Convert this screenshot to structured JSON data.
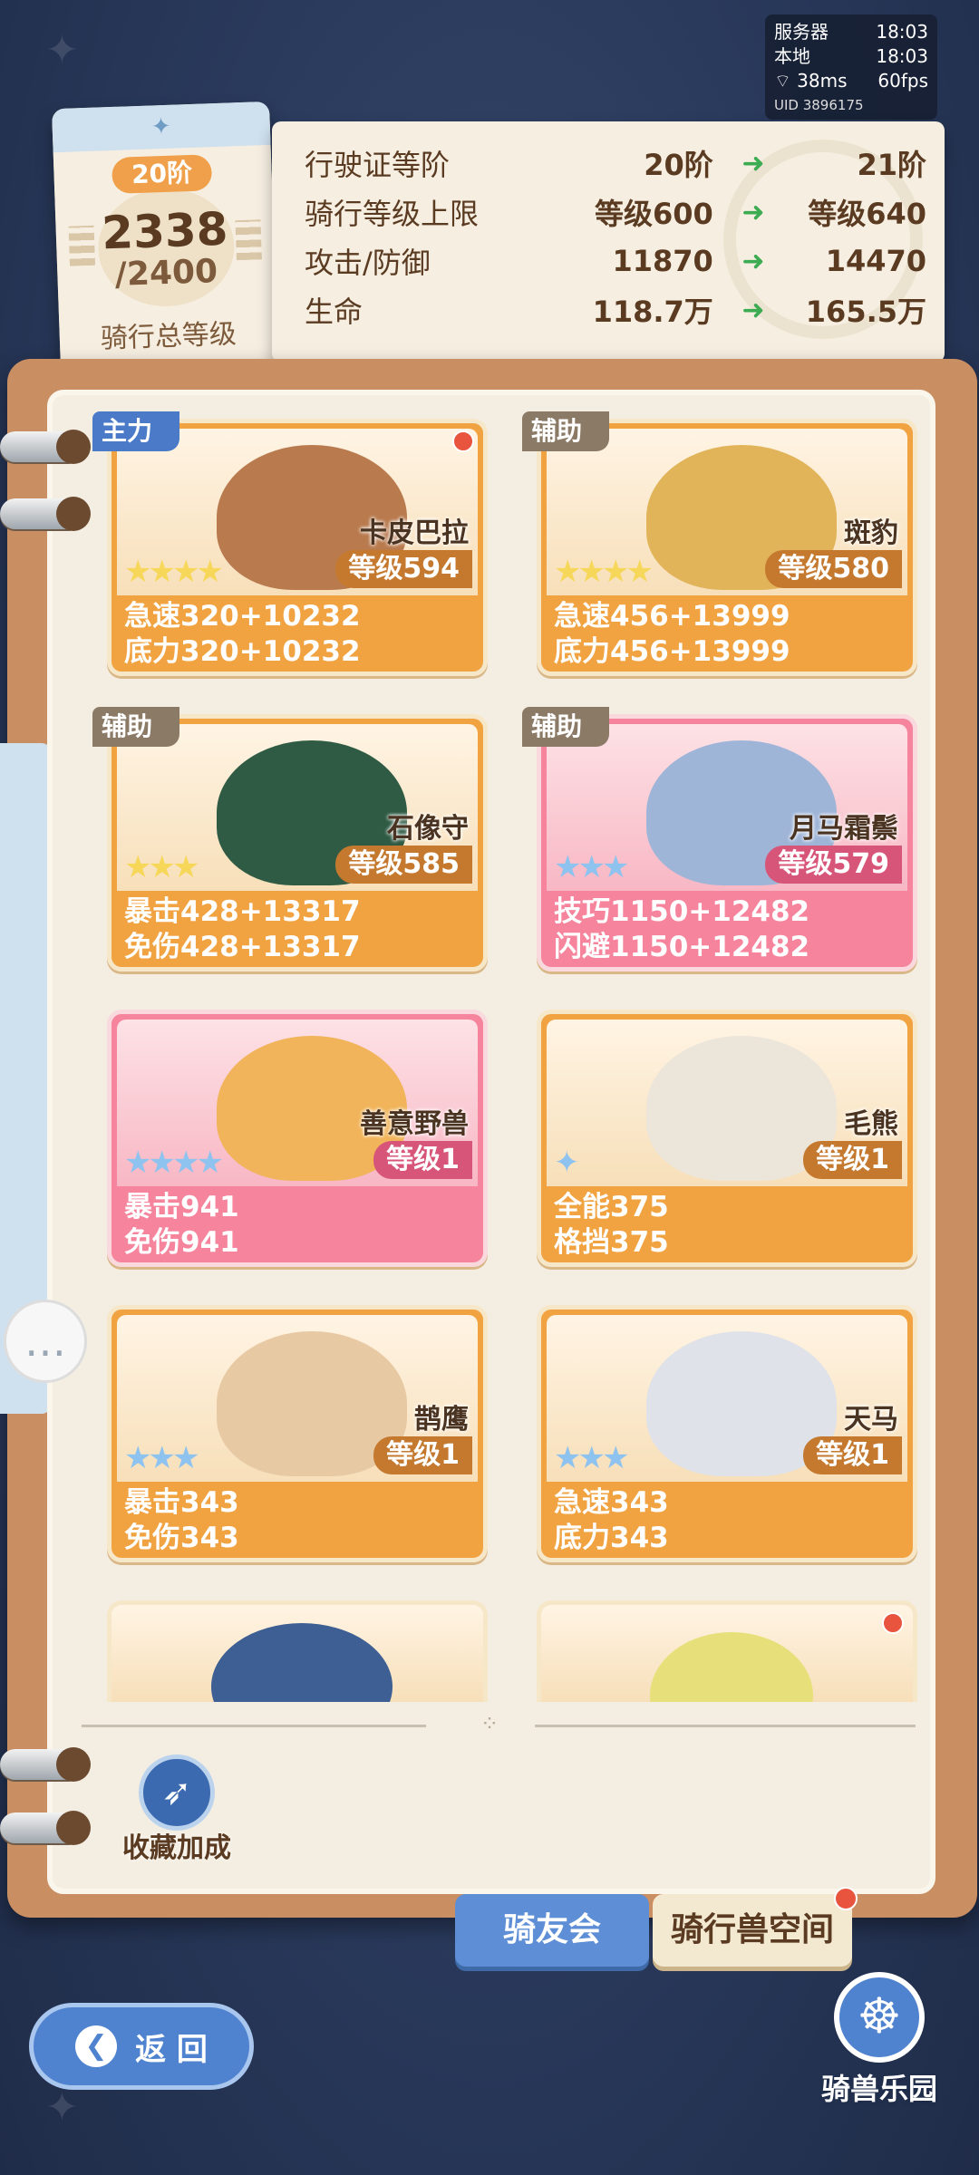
{
  "status": {
    "server_label": "服务器",
    "server_time": "18:03",
    "local_label": "本地",
    "local_time": "18:03",
    "ping": "38ms",
    "fps": "60fps",
    "uid": "UID 3896175"
  },
  "level_card": {
    "rank": "20阶",
    "level": "2338",
    "max": "/2400",
    "label": "骑行总等级"
  },
  "upgrade": {
    "rows": [
      {
        "label": "行驶证等阶",
        "current": "20阶",
        "next": "21阶"
      },
      {
        "label": "骑行等级上限",
        "current": "等级600",
        "next": "等级640"
      },
      {
        "label": "攻击/防御",
        "current": "11870",
        "next": "14470"
      },
      {
        "label": "生命",
        "current": "118.7万",
        "next": "165.5万"
      }
    ]
  },
  "mounts": [
    {
      "role": "主力",
      "name": "卡皮巴拉",
      "level": "等级594",
      "stars": "★★★★",
      "stat1": "急速320+10232",
      "stat2": "底力320+10232",
      "theme": "orange",
      "dot": true,
      "creature_color": "#b97a4e"
    },
    {
      "role": "辅助",
      "name": "斑豹",
      "level": "等级580",
      "stars": "★★★★",
      "stat1": "急速456+13999",
      "stat2": "底力456+13999",
      "theme": "orange",
      "dot": false,
      "creature_color": "#e2b45a"
    },
    {
      "role": "辅助",
      "name": "石像守",
      "level": "等级585",
      "stars": "★★★",
      "stat1": "暴击428+13317",
      "stat2": "免伤428+13317",
      "theme": "orange",
      "dot": false,
      "creature_color": "#2f5a44"
    },
    {
      "role": "辅助",
      "name": "月马霜鬃",
      "level": "等级579",
      "stars": "★★★",
      "stat1": "技巧1150+12482",
      "stat2": "闪避1150+12482",
      "theme": "pink",
      "dot": false,
      "creature_color": "#9fb5d8"
    },
    {
      "role": "",
      "name": "善意野兽",
      "level": "等级1",
      "stars": "★★★★",
      "stat1": "暴击941",
      "stat2": "免伤941",
      "theme": "pink",
      "dot": false,
      "creature_color": "#f1b45a"
    },
    {
      "role": "",
      "name": "毛熊",
      "level": "等级1",
      "stars": "✦",
      "stat1": "全能375",
      "stat2": "格挡375",
      "theme": "orange",
      "dot": false,
      "creature_color": "#ece6da"
    },
    {
      "role": "",
      "name": "鹊鹰",
      "level": "等级1",
      "stars": "★★★",
      "stat1": "暴击343",
      "stat2": "免伤343",
      "theme": "orange",
      "dot": false,
      "creature_color": "#e7c9a4"
    },
    {
      "role": "",
      "name": "天马",
      "level": "等级1",
      "stars": "★★★",
      "stat1": "急速343",
      "stat2": "底力343",
      "theme": "orange",
      "dot": false,
      "creature_color": "#dfe2e8"
    }
  ],
  "collect_bonus": "收藏加成",
  "tabs": {
    "friends": "骑友会",
    "space": "骑行兽空间"
  },
  "back": "返 回",
  "park": "骑兽乐园",
  "colors": {
    "accent_blue": "#4f82cf",
    "card_orange": "#f1a342",
    "card_pink": "#f5849c",
    "arrow_green": "#3cab52"
  }
}
